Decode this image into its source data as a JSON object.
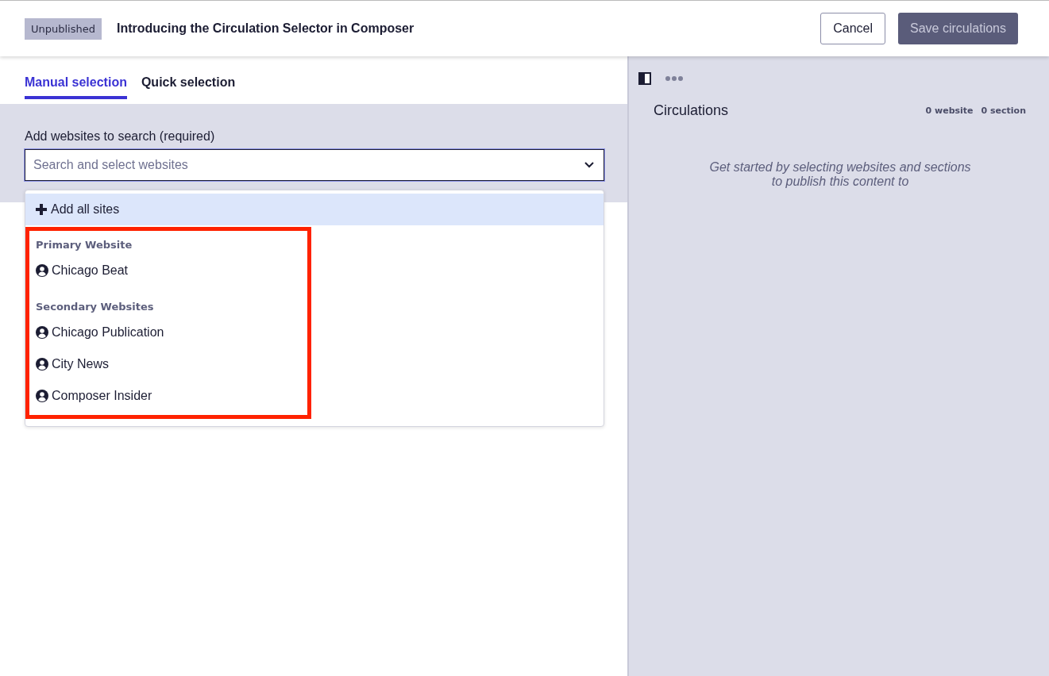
{
  "header": {
    "status_badge": "Unpublished",
    "title": "Introducing the Circulation Selector in Composer",
    "buttons": [
      {
        "label": "Cancel",
        "kind": "secondary"
      },
      {
        "label": "Save circulations",
        "kind": "primary"
      }
    ]
  },
  "tabs": [
    {
      "label": "Manual selection",
      "selected": true
    },
    {
      "label": "Quick selection",
      "selected": false
    }
  ],
  "website_search": {
    "label": "Add websites to search (required)",
    "placeholder": "Search and select websites"
  },
  "dropdown": {
    "add_all": "Add all sites",
    "groups": [
      {
        "heading": "Primary Website",
        "items": [
          "Chicago Beat"
        ]
      },
      {
        "heading": "Secondary Websites",
        "items": [
          "Chicago Publication",
          "City News",
          "Composer Insider"
        ]
      }
    ],
    "highlighted_groups": true
  },
  "circulations_panel": {
    "title": "Circulations",
    "counts": [
      "0 website",
      "0 section"
    ],
    "empty_message": "Get started by selecting websites and sections to publish this content to"
  }
}
